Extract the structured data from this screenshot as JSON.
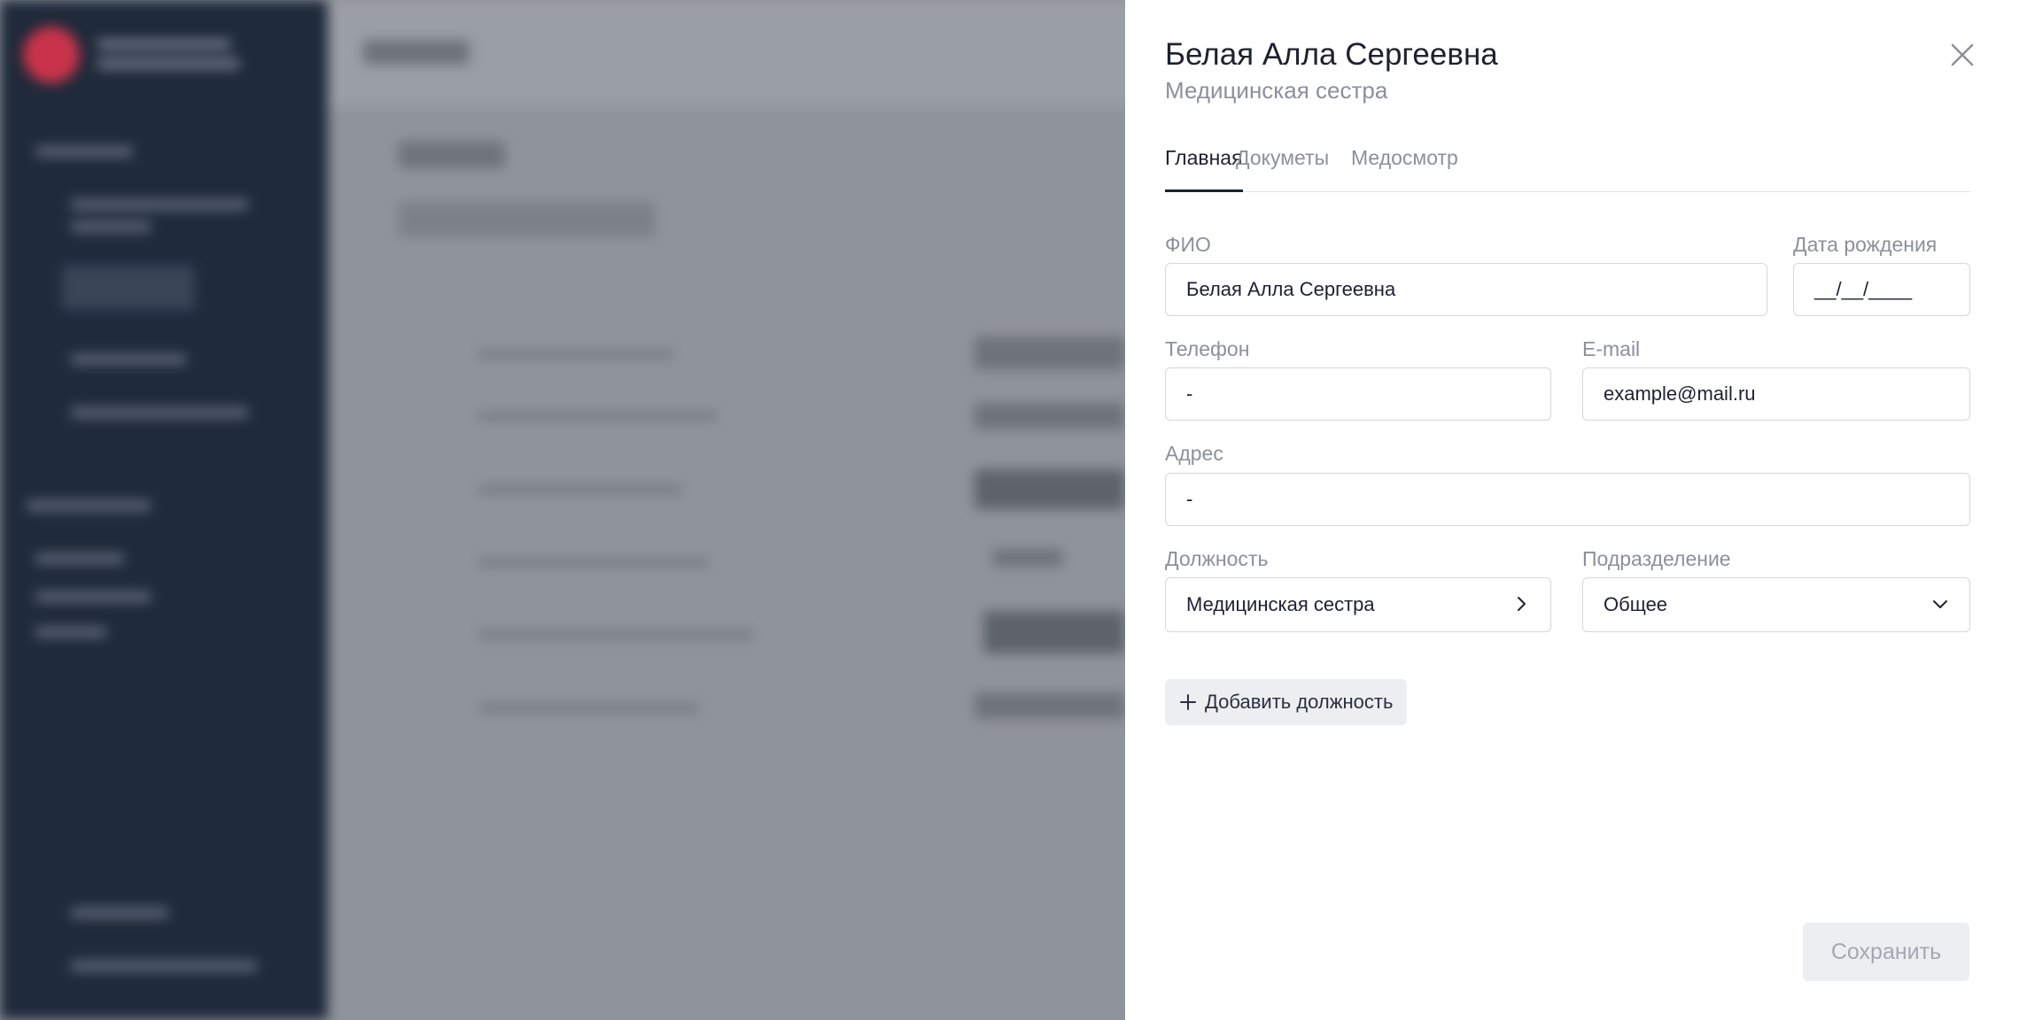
{
  "drawer": {
    "title": "Белая Алла Сергеевна",
    "subtitle": "Медицинская сестра",
    "tabs": [
      {
        "label": "Главная",
        "active": true
      },
      {
        "label": "Докуметы",
        "active": false
      },
      {
        "label": "Медосмотр",
        "active": false
      }
    ],
    "fields": {
      "fio": {
        "label": "ФИО",
        "value": "Белая Алла Сергеевна"
      },
      "birthdate": {
        "label": "Дата рождения",
        "value": "__/__/____"
      },
      "phone": {
        "label": "Телефон",
        "value": "-"
      },
      "email": {
        "label": "E-mail",
        "value": "example@mail.ru"
      },
      "address": {
        "label": "Адрес",
        "value": "-"
      },
      "position": {
        "label": "Должность",
        "value": "Медицинская сестра",
        "icon": "chevron-right-icon"
      },
      "department": {
        "label": "Подразделение",
        "value": "Общее",
        "icon": "chevron-down-icon"
      }
    },
    "add_position_label": "Добавить должность",
    "save_label": "Сохранить"
  },
  "colors": {
    "panel_bg": "#ffffff",
    "overlay": "#8f939a",
    "sidebar_bg": "#1f2a3a",
    "brand": "#c9334a",
    "text_primary": "#1d2230",
    "text_muted": "#8b909a",
    "border": "#d4d7dd",
    "button_bg": "#eceef1"
  }
}
